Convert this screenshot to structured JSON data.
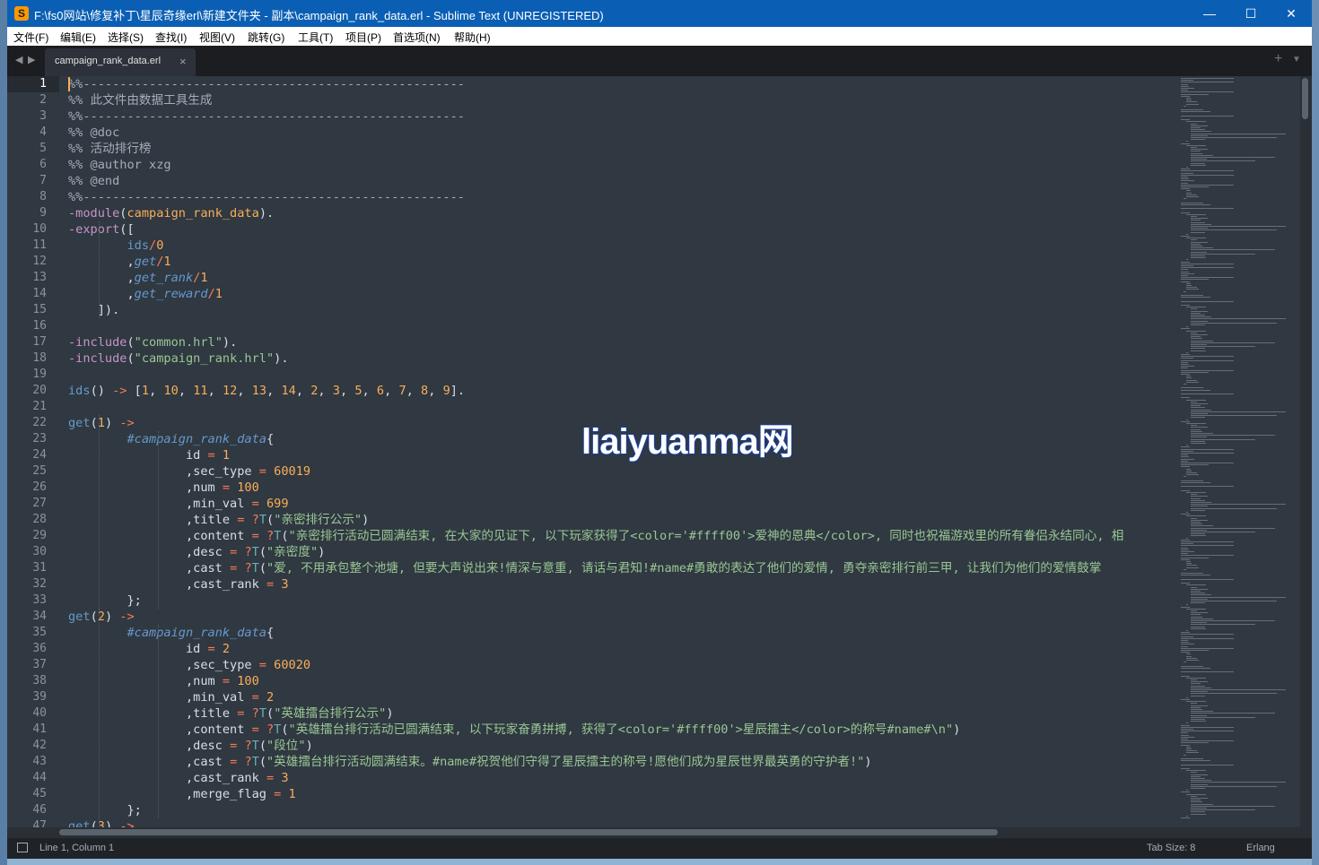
{
  "window": {
    "title": "F:\\fs0网站\\修复补丁\\星辰奇缘erl\\新建文件夹 - 副本\\campaign_rank_data.erl - Sublime Text (UNREGISTERED)",
    "icon": "sublime-text-icon",
    "min_label": "—",
    "max_label": "☐",
    "close_label": "✕"
  },
  "menu": [
    "文件(F)",
    "编辑(E)",
    "选择(S)",
    "查找(I)",
    "视图(V)",
    "跳转(G)",
    "工具(T)",
    "项目(P)",
    "首选项(N)",
    "帮助(H)"
  ],
  "tabs": {
    "active_label": "campaign_rank_data.erl",
    "close_label": "×",
    "new_tab_label": "+",
    "menu_label": "▼",
    "nav_left": "◀",
    "nav_right": "▶"
  },
  "editor": {
    "current_line": 1,
    "line_numbers": [
      "1",
      "2",
      "3",
      "4",
      "5",
      "6",
      "7",
      "8",
      "9",
      "10",
      "11",
      "12",
      "13",
      "14",
      "15",
      "16",
      "17",
      "18",
      "19",
      "20",
      "21",
      "22",
      "23",
      "24",
      "25",
      "26",
      "27",
      "28",
      "29",
      "30",
      "31",
      "32",
      "33",
      "34",
      "35",
      "36",
      "37",
      "38",
      "39",
      "40",
      "41",
      "42",
      "43",
      "44",
      "45",
      "46",
      "47"
    ],
    "lines": [
      [
        [
          "c",
          "%%----------------------------------------------------"
        ]
      ],
      [
        [
          "c",
          "%% 此文件由数据工具生成"
        ]
      ],
      [
        [
          "c",
          "%%----------------------------------------------------"
        ]
      ],
      [
        [
          "c",
          "%% @doc"
        ]
      ],
      [
        [
          "c",
          "%% 活动排行榜"
        ]
      ],
      [
        [
          "c",
          "%% @author xzg"
        ]
      ],
      [
        [
          "c",
          "%% @end"
        ]
      ],
      [
        [
          "c",
          "%%----------------------------------------------------"
        ]
      ],
      [
        [
          "kw",
          "-module"
        ],
        [
          "p",
          "("
        ],
        [
          "num",
          "campaign_rank_data"
        ],
        [
          "p",
          ")."
        ]
      ],
      [
        [
          "kw",
          "-export"
        ],
        [
          "p",
          "(["
        ]
      ],
      [
        [
          "p",
          "        "
        ],
        [
          "fn",
          "ids"
        ],
        [
          "op",
          "/"
        ],
        [
          "num",
          "0"
        ]
      ],
      [
        [
          "p",
          "        ,"
        ],
        [
          "rec",
          "get"
        ],
        [
          "op",
          "/"
        ],
        [
          "num",
          "1"
        ]
      ],
      [
        [
          "p",
          "        ,"
        ],
        [
          "rec",
          "get_rank"
        ],
        [
          "op",
          "/"
        ],
        [
          "num",
          "1"
        ]
      ],
      [
        [
          "p",
          "        ,"
        ],
        [
          "rec",
          "get_reward"
        ],
        [
          "op",
          "/"
        ],
        [
          "num",
          "1"
        ]
      ],
      [
        [
          "p",
          "    ])."
        ]
      ],
      [],
      [
        [
          "kw",
          "-include"
        ],
        [
          "p",
          "("
        ],
        [
          "str",
          "\"common.hrl\""
        ],
        [
          "p",
          ")."
        ]
      ],
      [
        [
          "kw",
          "-include"
        ],
        [
          "p",
          "("
        ],
        [
          "str",
          "\"campaign_rank.hrl\""
        ],
        [
          "p",
          ")."
        ]
      ],
      [],
      [
        [
          "fn",
          "ids"
        ],
        [
          "p",
          "() "
        ],
        [
          "op",
          "->"
        ],
        [
          "p",
          " ["
        ],
        [
          "num",
          "1"
        ],
        [
          "p",
          ", "
        ],
        [
          "num",
          "10"
        ],
        [
          "p",
          ", "
        ],
        [
          "num",
          "11"
        ],
        [
          "p",
          ", "
        ],
        [
          "num",
          "12"
        ],
        [
          "p",
          ", "
        ],
        [
          "num",
          "13"
        ],
        [
          "p",
          ", "
        ],
        [
          "num",
          "14"
        ],
        [
          "p",
          ", "
        ],
        [
          "num",
          "2"
        ],
        [
          "p",
          ", "
        ],
        [
          "num",
          "3"
        ],
        [
          "p",
          ", "
        ],
        [
          "num",
          "5"
        ],
        [
          "p",
          ", "
        ],
        [
          "num",
          "6"
        ],
        [
          "p",
          ", "
        ],
        [
          "num",
          "7"
        ],
        [
          "p",
          ", "
        ],
        [
          "num",
          "8"
        ],
        [
          "p",
          ", "
        ],
        [
          "num",
          "9"
        ],
        [
          "p",
          "]."
        ]
      ],
      [],
      [
        [
          "fn",
          "get"
        ],
        [
          "p",
          "("
        ],
        [
          "num",
          "1"
        ],
        [
          "p",
          ") "
        ],
        [
          "op",
          "->"
        ]
      ],
      [
        [
          "p",
          "        "
        ],
        [
          "rec",
          "#campaign_rank_data"
        ],
        [
          "p",
          "{"
        ]
      ],
      [
        [
          "p",
          "                id "
        ],
        [
          "op",
          "="
        ],
        [
          "p",
          " "
        ],
        [
          "num",
          "1"
        ]
      ],
      [
        [
          "p",
          "                ,sec_type "
        ],
        [
          "op",
          "="
        ],
        [
          "p",
          " "
        ],
        [
          "num",
          "60019"
        ]
      ],
      [
        [
          "p",
          "                ,num "
        ],
        [
          "op",
          "="
        ],
        [
          "p",
          " "
        ],
        [
          "num",
          "100"
        ]
      ],
      [
        [
          "p",
          "                ,min_val "
        ],
        [
          "op",
          "="
        ],
        [
          "p",
          " "
        ],
        [
          "num",
          "699"
        ]
      ],
      [
        [
          "p",
          "                ,title "
        ],
        [
          "op",
          "="
        ],
        [
          "p",
          " "
        ],
        [
          "op",
          "?"
        ],
        [
          "at",
          "T"
        ],
        [
          "p",
          "("
        ],
        [
          "str",
          "\"亲密排行公示\""
        ],
        [
          "p",
          ")"
        ]
      ],
      [
        [
          "p",
          "                ,content "
        ],
        [
          "op",
          "="
        ],
        [
          "p",
          " "
        ],
        [
          "op",
          "?"
        ],
        [
          "at",
          "T"
        ],
        [
          "p",
          "("
        ],
        [
          "str",
          "\"亲密排行活动已圆满结束, 在大家的见证下, 以下玩家获得了<color='#ffff00'>爱神的恩典</color>, 同时也祝福游戏里的所有眷侣永结同心, 相"
        ]
      ],
      [
        [
          "p",
          "                ,desc "
        ],
        [
          "op",
          "="
        ],
        [
          "p",
          " "
        ],
        [
          "op",
          "?"
        ],
        [
          "at",
          "T"
        ],
        [
          "p",
          "("
        ],
        [
          "str",
          "\"亲密度\""
        ],
        [
          "p",
          ")"
        ]
      ],
      [
        [
          "p",
          "                ,cast "
        ],
        [
          "op",
          "="
        ],
        [
          "p",
          " "
        ],
        [
          "op",
          "?"
        ],
        [
          "at",
          "T"
        ],
        [
          "p",
          "("
        ],
        [
          "str",
          "\"爱, 不用承包整个池塘, 但要大声说出来!情深与意重, 请话与君知!#name#勇敢的表达了他们的爱情, 勇夺亲密排行前三甲, 让我们为他们的爱情鼓掌"
        ]
      ],
      [
        [
          "p",
          "                ,cast_rank "
        ],
        [
          "op",
          "="
        ],
        [
          "p",
          " "
        ],
        [
          "num",
          "3"
        ]
      ],
      [
        [
          "p",
          "        };"
        ]
      ],
      [
        [
          "fn",
          "get"
        ],
        [
          "p",
          "("
        ],
        [
          "num",
          "2"
        ],
        [
          "p",
          ") "
        ],
        [
          "op",
          "->"
        ]
      ],
      [
        [
          "p",
          "        "
        ],
        [
          "rec",
          "#campaign_rank_data"
        ],
        [
          "p",
          "{"
        ]
      ],
      [
        [
          "p",
          "                id "
        ],
        [
          "op",
          "="
        ],
        [
          "p",
          " "
        ],
        [
          "num",
          "2"
        ]
      ],
      [
        [
          "p",
          "                ,sec_type "
        ],
        [
          "op",
          "="
        ],
        [
          "p",
          " "
        ],
        [
          "num",
          "60020"
        ]
      ],
      [
        [
          "p",
          "                ,num "
        ],
        [
          "op",
          "="
        ],
        [
          "p",
          " "
        ],
        [
          "num",
          "100"
        ]
      ],
      [
        [
          "p",
          "                ,min_val "
        ],
        [
          "op",
          "="
        ],
        [
          "p",
          " "
        ],
        [
          "num",
          "2"
        ]
      ],
      [
        [
          "p",
          "                ,title "
        ],
        [
          "op",
          "="
        ],
        [
          "p",
          " "
        ],
        [
          "op",
          "?"
        ],
        [
          "at",
          "T"
        ],
        [
          "p",
          "("
        ],
        [
          "str",
          "\"英雄擂台排行公示\""
        ],
        [
          "p",
          ")"
        ]
      ],
      [
        [
          "p",
          "                ,content "
        ],
        [
          "op",
          "="
        ],
        [
          "p",
          " "
        ],
        [
          "op",
          "?"
        ],
        [
          "at",
          "T"
        ],
        [
          "p",
          "("
        ],
        [
          "str",
          "\"英雄擂台排行活动已圆满结束, 以下玩家奋勇拼搏, 获得了<color='#ffff00'>星辰擂主</color>的称号#name#\\n\""
        ],
        [
          "p",
          ")"
        ]
      ],
      [
        [
          "p",
          "                ,desc "
        ],
        [
          "op",
          "="
        ],
        [
          "p",
          " "
        ],
        [
          "op",
          "?"
        ],
        [
          "at",
          "T"
        ],
        [
          "p",
          "("
        ],
        [
          "str",
          "\"段位\""
        ],
        [
          "p",
          ")"
        ]
      ],
      [
        [
          "p",
          "                ,cast "
        ],
        [
          "op",
          "="
        ],
        [
          "p",
          " "
        ],
        [
          "op",
          "?"
        ],
        [
          "at",
          "T"
        ],
        [
          "p",
          "("
        ],
        [
          "str",
          "\"英雄擂台排行活动圆满结束。#name#祝贺他们守得了星辰擂主的称号!愿他们成为星辰世界最英勇的守护者!\""
        ],
        [
          "p",
          ")"
        ]
      ],
      [
        [
          "p",
          "                ,cast_rank "
        ],
        [
          "op",
          "="
        ],
        [
          "p",
          " "
        ],
        [
          "num",
          "3"
        ]
      ],
      [
        [
          "p",
          "                ,merge_flag "
        ],
        [
          "op",
          "="
        ],
        [
          "p",
          " "
        ],
        [
          "num",
          "1"
        ]
      ],
      [
        [
          "p",
          "        };"
        ]
      ],
      [
        [
          "fn",
          "get"
        ],
        [
          "p",
          "("
        ],
        [
          "num",
          "3"
        ],
        [
          "p",
          ") "
        ],
        [
          "op",
          "->"
        ]
      ]
    ]
  },
  "status": {
    "position": "Line 1, Column 1",
    "tab_size": "Tab Size: 8",
    "syntax": "Erlang"
  },
  "watermark": "liaiyuanma网",
  "colors": {
    "editor_bg": "#303841",
    "comment": "#a6acb9",
    "keyword": "#c695c6",
    "function": "#6699cc",
    "number": "#f9ae58",
    "string": "#99c794",
    "operator": "#f97b58"
  }
}
